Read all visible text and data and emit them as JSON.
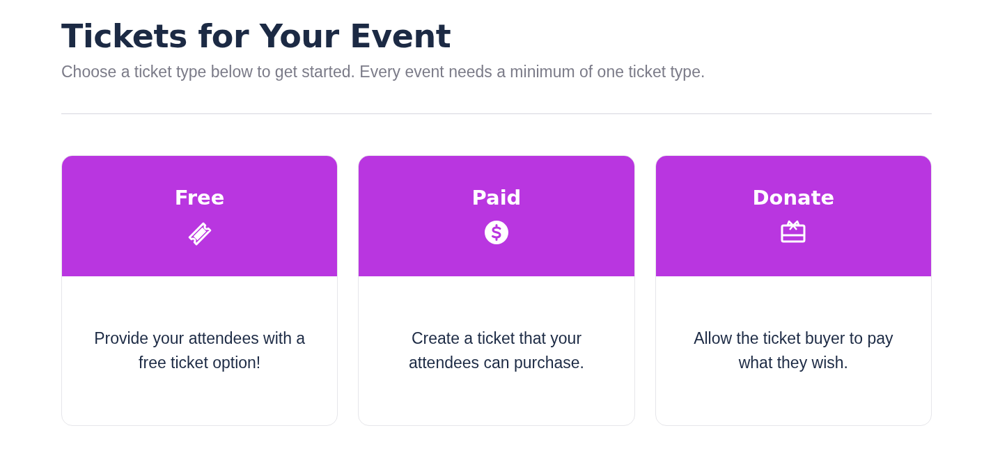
{
  "title": "Tickets for Your Event",
  "subtitle": "Choose a ticket type below to get started. Every event needs a minimum of one ticket type.",
  "ticket_types": [
    {
      "name": "Free",
      "kind": "ticket",
      "description": "Provide your attendees with a free ticket option!"
    },
    {
      "name": "Paid",
      "kind": "dollar",
      "description": "Create a ticket that your attendees can purchase."
    },
    {
      "name": "Donate",
      "kind": "gift",
      "description": "Allow the ticket buyer to pay what they wish."
    }
  ]
}
